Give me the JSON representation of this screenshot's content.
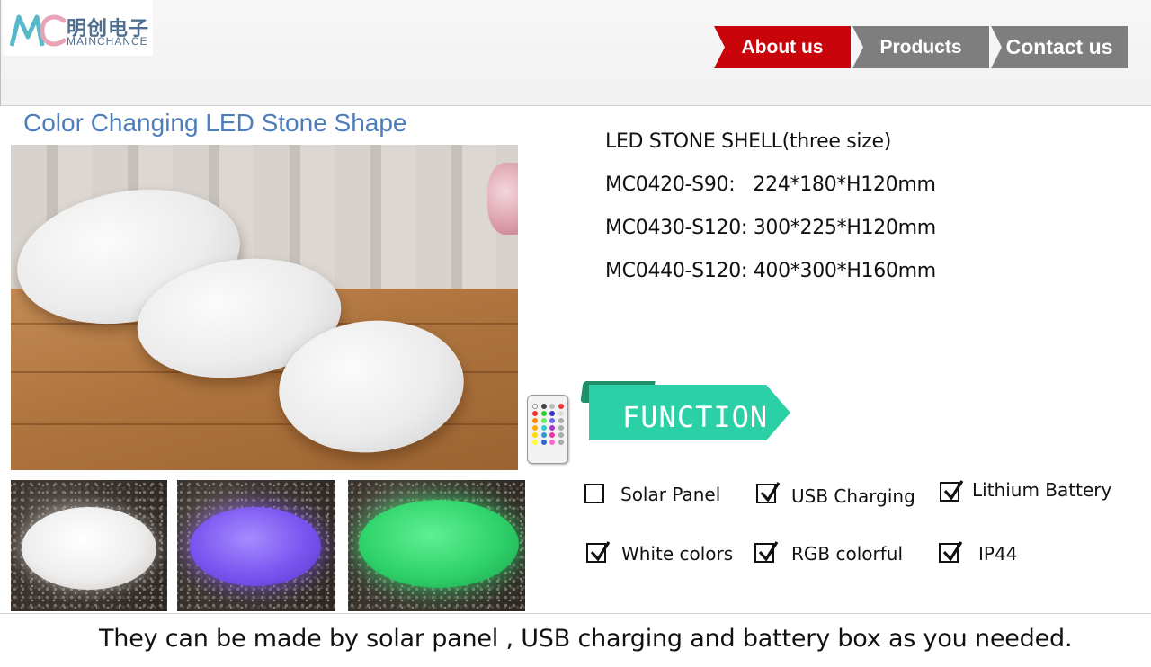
{
  "brand": {
    "name_cn": "明创电子",
    "name_en": "MAINCHANCE",
    "colors": {
      "primary": "#4f6f90",
      "accent": "#c9040b"
    }
  },
  "nav": {
    "items": [
      {
        "label": "About us",
        "active": true
      },
      {
        "label": "Products",
        "active": false
      },
      {
        "label": "Contact us",
        "active": false
      }
    ]
  },
  "product": {
    "title": "Color Changing LED Stone Shape",
    "specs": [
      "LED STONE SHELL(three size)",
      "MC0420-S90:   224*180*H120mm",
      "MC0430-S120: 300*225*H120mm",
      "MC0440-S120: 400*300*H160mm"
    ],
    "thumbnails": [
      {
        "glow": "white",
        "color": "#ededed"
      },
      {
        "glow": "purple",
        "color": "#7a55f0"
      },
      {
        "glow": "green",
        "color": "#2fd36a"
      }
    ]
  },
  "function": {
    "label": "FUNCTION",
    "color": "#2bd0a6",
    "options": [
      {
        "label": "Solar Panel",
        "checked": false
      },
      {
        "label": "USB Charging",
        "checked": true
      },
      {
        "label": "Lithium Battery",
        "checked": true
      },
      {
        "label": "White colors",
        "checked": true
      },
      {
        "label": "RGB colorful",
        "checked": true
      },
      {
        "label": "IP44",
        "checked": true
      }
    ]
  },
  "footer": {
    "note": "They can be made by solar panel , USB charging and battery box as you needed."
  }
}
